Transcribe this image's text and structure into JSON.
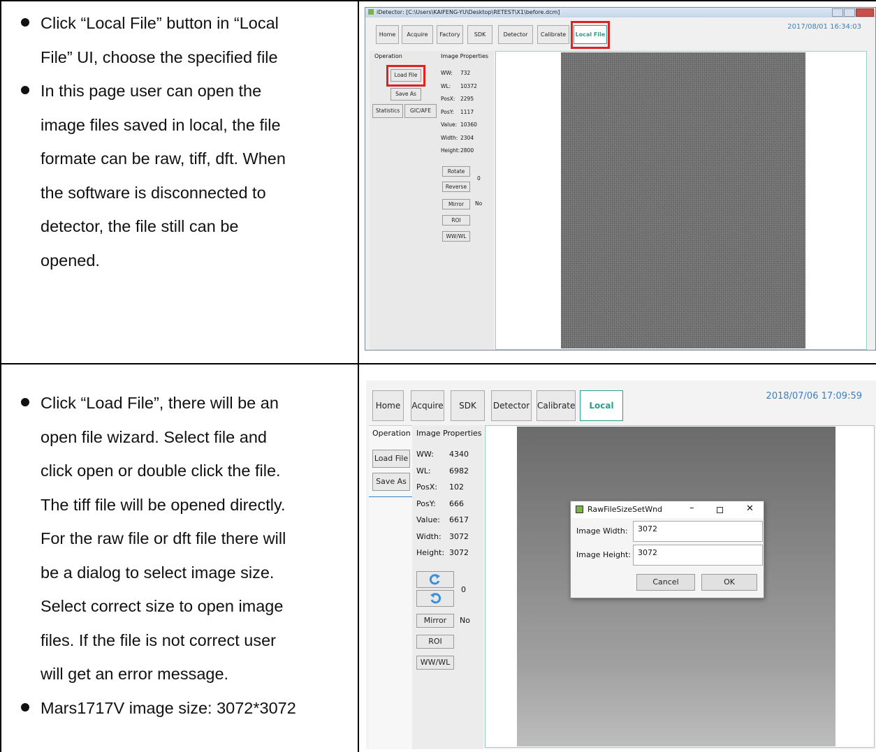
{
  "row1": {
    "bullets": [
      "Click “Local File” button in “Local File” UI, choose the specified file",
      "In this page user can open the image files saved in local, the file formate can be raw, tiff, dft. When the software is disconnected to detector, the file still can be opened."
    ],
    "bullet_lines": [
      [
        "Click “Local File” button in “Local",
        "File” UI, choose the specified file"
      ],
      [
        "In this page user can open the",
        "image files saved in local, the file",
        "formate can be raw, tiff, dft. When",
        "the software is disconnected to",
        "detector, the file still can be",
        "opened."
      ]
    ],
    "screenshot": {
      "window_title": "iDetector: [C:\\Users\\KAIFENG-YU\\Desktop\\RETEST\\X1\\before.dcm]",
      "datetime": "2017/08/01 16:34:03",
      "tabs": [
        "Home",
        "Acquire",
        "Factory",
        "SDK",
        "Detector",
        "Calibrate",
        "Local File"
      ],
      "active_tab": "Local File",
      "panel_headers": {
        "operation": "Operation",
        "properties": "Image Properties"
      },
      "op_buttons": {
        "load": "Load File",
        "save": "Save As",
        "statistics": "Statistics",
        "gic": "GIC/AFE"
      },
      "properties": [
        {
          "label": "WW:",
          "value": "732"
        },
        {
          "label": "WL:",
          "value": "10372"
        },
        {
          "label": "PosX:",
          "value": "2295"
        },
        {
          "label": "PosY:",
          "value": "1117"
        },
        {
          "label": "Value:",
          "value": "10360"
        },
        {
          "label": "Width:",
          "value": "2304"
        },
        {
          "label": "Height:",
          "value": "2800"
        }
      ],
      "tools": {
        "rotate": "Rotate",
        "reverse": "Reverse",
        "rotate_value": "0",
        "mirror": "Mirror",
        "mirror_value": "No",
        "roi": "ROI",
        "wwwl": "WW/WL"
      },
      "highlight_color": "#d22222"
    }
  },
  "row2": {
    "bullet_lines": [
      [
        "Click “Load File”, there will be an",
        "open file wizard. Select file and",
        "click open or double click the file.",
        "The tiff file will be opened directly.",
        "For the raw file or dft file there will",
        "be a dialog to select image size.",
        "Select correct size to open image",
        "files. If the file is not correct user",
        "will get an error message."
      ],
      [
        "Mars1717V image size: 3072*3072"
      ]
    ],
    "screenshot": {
      "datetime": "2018/07/06 17:09:59",
      "tabs": [
        "Home",
        "Acquire",
        "SDK",
        "Detector",
        "Calibrate",
        "Local File"
      ],
      "active_tab": "Local File",
      "panel_headers": {
        "operation": "Operation",
        "properties": "Image Properties"
      },
      "op_buttons": {
        "load": "Load File",
        "save": "Save As"
      },
      "properties": [
        {
          "label": "WW:",
          "value": "4340"
        },
        {
          "label": "WL:",
          "value": "6982"
        },
        {
          "label": "PosX:",
          "value": "102"
        },
        {
          "label": "PosY:",
          "value": "666"
        },
        {
          "label": "Value:",
          "value": "6617"
        },
        {
          "label": "Width:",
          "value": "3072"
        },
        {
          "label": "Height:",
          "value": "3072"
        }
      ],
      "tools": {
        "rotate_value": "0",
        "mirror": "Mirror",
        "mirror_value": "No",
        "roi": "ROI",
        "wwwl": "WW/WL"
      },
      "dialog": {
        "title": "RawFileSizeSetWnd",
        "width_label": "Image Width:",
        "width_value": "3072",
        "height_label": "Image Height:",
        "height_value": "3072",
        "cancel": "Cancel",
        "ok": "OK"
      },
      "accent_color": "#2a9d8f"
    }
  }
}
